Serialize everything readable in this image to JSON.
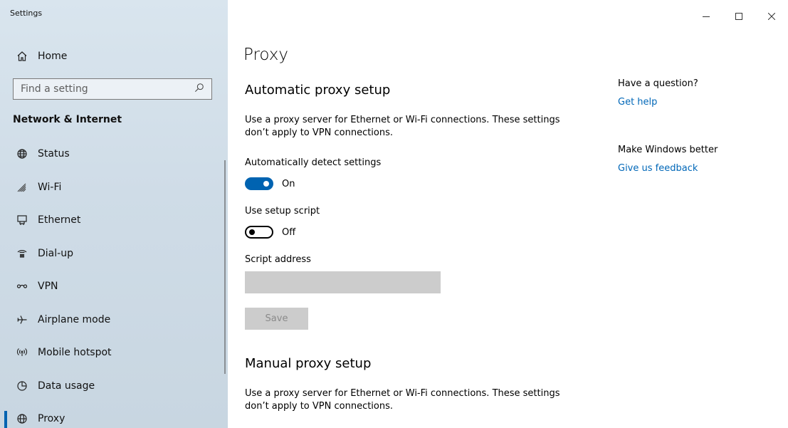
{
  "window": {
    "app_title": "Settings"
  },
  "sidebar": {
    "home_label": "Home",
    "search_placeholder": "Find a setting",
    "section_title": "Network & Internet",
    "items": [
      {
        "label": "Status",
        "icon": "globe-status-icon"
      },
      {
        "label": "Wi-Fi",
        "icon": "wifi-icon"
      },
      {
        "label": "Ethernet",
        "icon": "ethernet-icon"
      },
      {
        "label": "Dial-up",
        "icon": "dialup-icon"
      },
      {
        "label": "VPN",
        "icon": "vpn-icon"
      },
      {
        "label": "Airplane mode",
        "icon": "airplane-icon"
      },
      {
        "label": "Mobile hotspot",
        "icon": "hotspot-icon"
      },
      {
        "label": "Data usage",
        "icon": "data-usage-icon"
      },
      {
        "label": "Proxy",
        "icon": "proxy-globe-icon",
        "selected": true
      }
    ]
  },
  "main": {
    "title": "Proxy",
    "auto": {
      "heading": "Automatic proxy setup",
      "desc_line1": "Use a proxy server for Ethernet or Wi-Fi connections. These settings",
      "desc_line2": "don’t apply to VPN connections.",
      "detect_label": "Automatically detect settings",
      "detect_state": "On",
      "script_label": "Use setup script",
      "script_state": "Off",
      "address_label": "Script address",
      "address_value": "",
      "save_label": "Save"
    },
    "manual": {
      "heading": "Manual proxy setup",
      "desc_line1": "Use a proxy server for Ethernet or Wi-Fi connections. These settings",
      "desc_line2": "don’t apply to VPN connections."
    }
  },
  "aside": {
    "question_heading": "Have a question?",
    "help_link": "Get help",
    "better_heading": "Make Windows better",
    "feedback_link": "Give us feedback"
  },
  "colors": {
    "accent": "#0063b1",
    "link": "#0067b8",
    "sidebar_bg": "#cfdce7",
    "disabled": "#cccccc"
  }
}
